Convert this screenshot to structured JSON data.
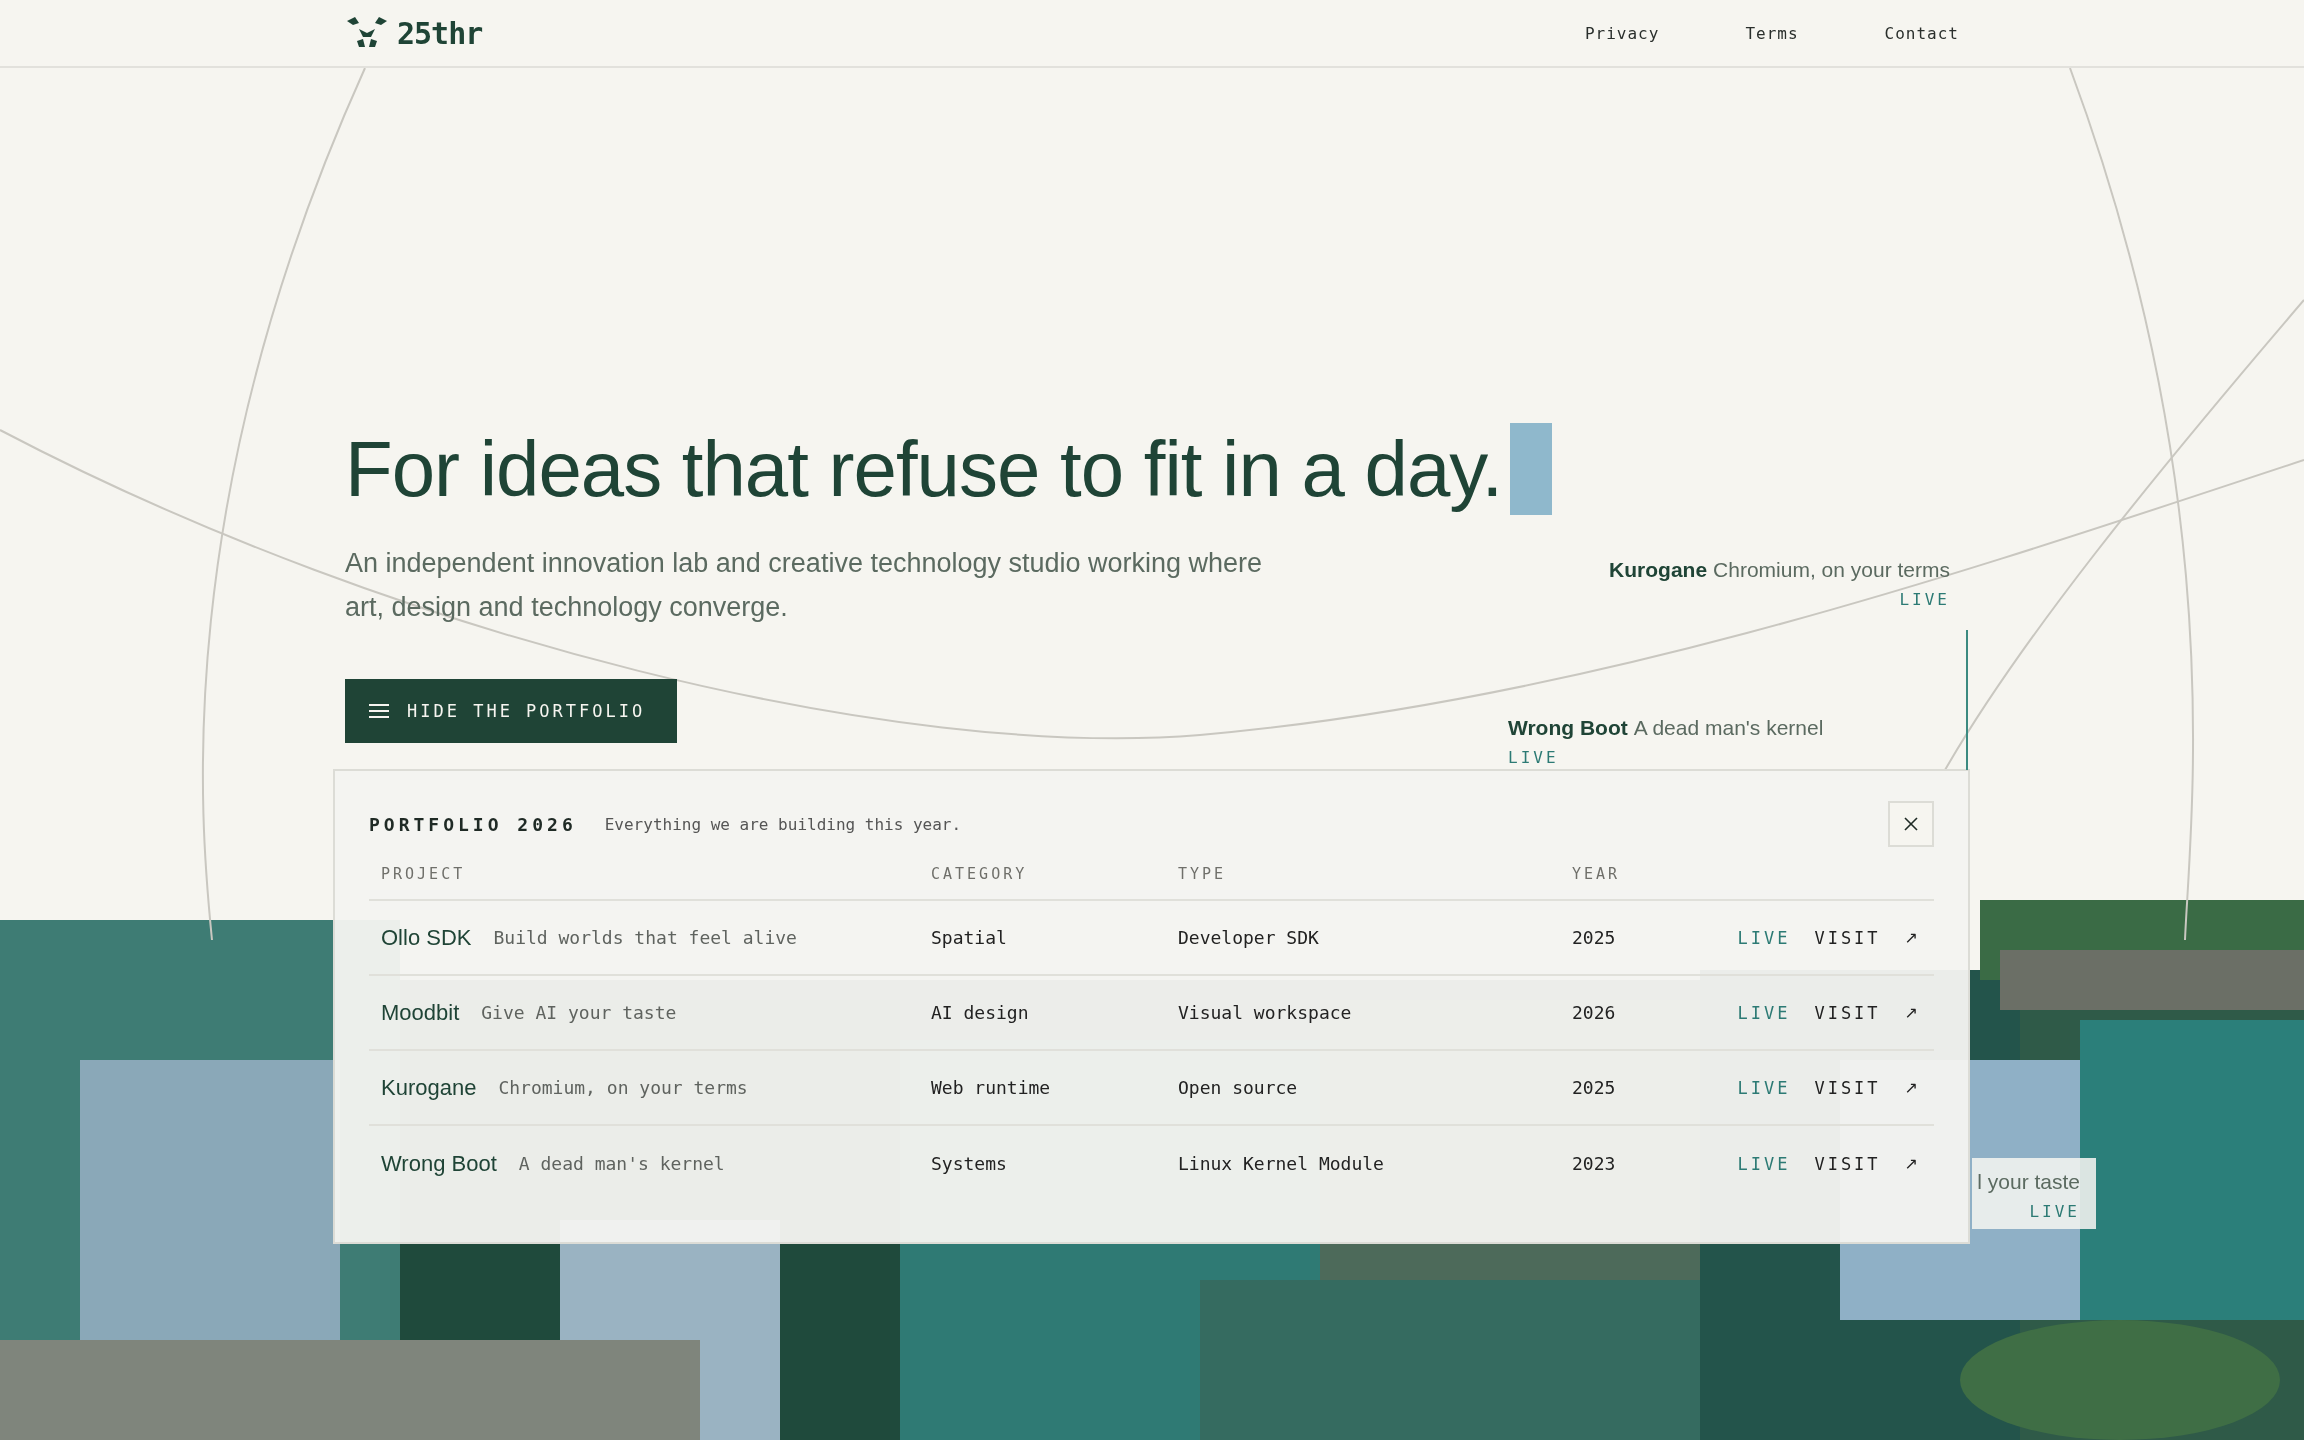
{
  "header": {
    "logo": "25thr",
    "nav": [
      {
        "label": "Privacy"
      },
      {
        "label": "Terms"
      },
      {
        "label": "Contact"
      }
    ]
  },
  "hero": {
    "title": "For ideas that refuse to fit in a day.",
    "subtitle": "An independent innovation lab and creative technology studio working where art, design and technology converge.",
    "button": "HIDE THE PORTFOLIO"
  },
  "floating_labels": [
    {
      "name": "Kurogane",
      "tagline": "Chromium, on your terms",
      "status": "LIVE"
    },
    {
      "name": "Wrong Boot",
      "tagline": "A dead man's kernel",
      "status": "LIVE"
    },
    {
      "tagline": "l your taste",
      "status": "LIVE"
    }
  ],
  "portfolio": {
    "title": "PORTFOLIO 2026",
    "subtitle": "Everything we are building this year.",
    "columns": [
      "PROJECT",
      "CATEGORY",
      "TYPE",
      "YEAR"
    ],
    "rows": [
      {
        "project": "Ollo SDK",
        "tagline": "Build worlds that feel alive",
        "category": "Spatial",
        "type": "Developer SDK",
        "year": "2025",
        "status": "LIVE",
        "action": "VISIT",
        "arrow": "↗"
      },
      {
        "project": "Moodbit",
        "tagline": "Give AI your taste",
        "category": "AI design",
        "type": "Visual workspace",
        "year": "2026",
        "status": "LIVE",
        "action": "VISIT",
        "arrow": "↗"
      },
      {
        "project": "Kurogane",
        "tagline": "Chromium, on your terms",
        "category": "Web runtime",
        "type": "Open source",
        "year": "2025",
        "status": "LIVE",
        "action": "VISIT",
        "arrow": "↗"
      },
      {
        "project": "Wrong Boot",
        "tagline": "A dead man's kernel",
        "category": "Systems",
        "type": "Linux Kernel Module",
        "year": "2023",
        "status": "LIVE",
        "action": "VISIT",
        "arrow": "↗"
      }
    ]
  }
}
